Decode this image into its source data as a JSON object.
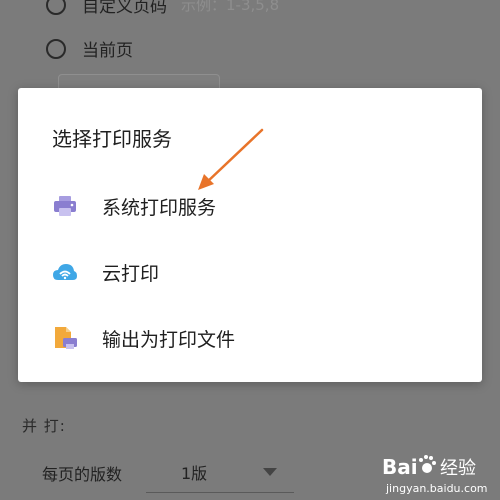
{
  "background": {
    "range_options": [
      {
        "label": "自定义页码",
        "hint": "示例：1-3,5,8"
      },
      {
        "label": "当前页"
      }
    ],
    "section_title": "并 打:",
    "pages_per_sheet": {
      "label": "每页的版数",
      "value": "1版"
    }
  },
  "dialog": {
    "title": "选择打印服务",
    "options": [
      {
        "label": "系统打印服务",
        "icon": "printer-icon"
      },
      {
        "label": "云打印",
        "icon": "cloud-print-icon"
      },
      {
        "label": "输出为打印文件",
        "icon": "print-file-icon"
      }
    ]
  },
  "annotation": {
    "arrow_color": "#e8742a",
    "target": "系统打印服务"
  },
  "watermark": {
    "brand": "Bai",
    "brand2": "经验",
    "url": "jingyan.baidu.com"
  },
  "colors": {
    "overlay": "#7b7b7b",
    "dialog_bg": "#ffffff",
    "printer_icon": "#8a7ed0",
    "cloud_icon": "#3fa7e6",
    "file_icon": "#f2a93b"
  }
}
